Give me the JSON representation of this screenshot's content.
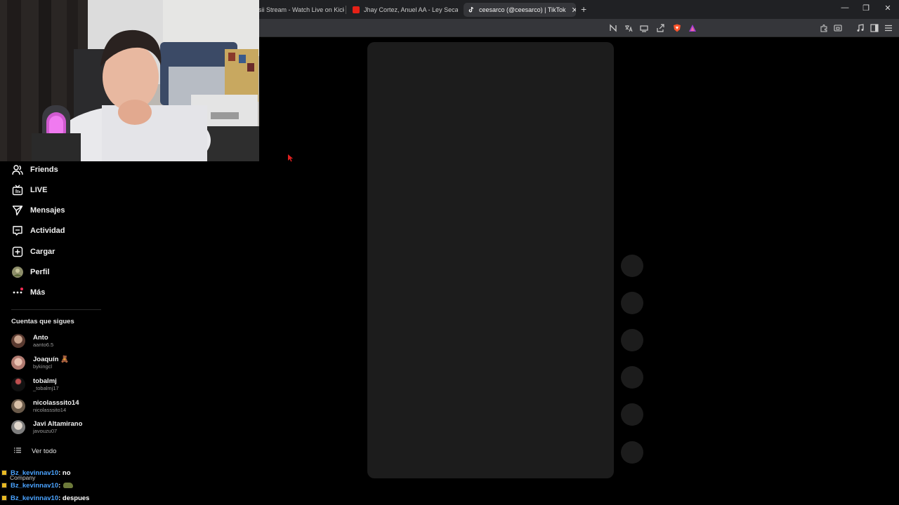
{
  "browser": {
    "tabs": [
      {
        "title": "sii Stream - Watch Live on Kick",
        "active": false,
        "favicon": "kick-icon"
      },
      {
        "title": "Jhay Cortez, Anuel AA - Ley Seca (Offi",
        "active": false,
        "favicon": "youtube-icon"
      },
      {
        "title": "ceesarco (@ceesarco) | TikTok",
        "active": true,
        "favicon": "tiktok-icon"
      }
    ],
    "new_tab_glyph": "+",
    "close_glyph": "✕",
    "window_controls": {
      "minimize": "—",
      "restore": "❐",
      "close": "✕"
    },
    "accent": "#35363a"
  },
  "sidebar": {
    "nav": [
      {
        "label": "Friends",
        "icon": "friends-icon"
      },
      {
        "label": "LIVE",
        "icon": "live-tv-icon"
      },
      {
        "label": "Mensajes",
        "icon": "send-icon"
      },
      {
        "label": "Actividad",
        "icon": "activity-icon"
      },
      {
        "label": "Cargar",
        "icon": "upload-plus-icon"
      },
      {
        "label": "Perfil",
        "icon": "profile-avatar-icon"
      },
      {
        "label": "Más",
        "icon": "more-dots-icon"
      }
    ],
    "following_title": "Cuentas que sigues",
    "accounts": [
      {
        "name": "Anto",
        "handle": "aanto6.5",
        "avatar_color": "#7a5a4a"
      },
      {
        "name": "Joaquín 🧸",
        "handle": "bykingcl",
        "avatar_color": "#c99a8a"
      },
      {
        "name": "tobalmj",
        "handle": "_tobalmj17",
        "avatar_color": "#2a2a2a"
      },
      {
        "name": "nicolasssito14",
        "handle": "nicolasssito14",
        "avatar_color": "#8a7a6a"
      },
      {
        "name": "Javi Altamirano",
        "handle": "javouzu07",
        "avatar_color": "#9a9a9a"
      }
    ],
    "see_all": "Ver todo"
  },
  "chat": {
    "messages": [
      {
        "user": "Bz_kevinnav10",
        "text": " : no",
        "emote": false
      },
      {
        "user": "Bz_kevinnav10",
        "text": " : ",
        "emote": true
      },
      {
        "user": "Bz_kevinnav10",
        "text": " : despues",
        "emote": false
      }
    ],
    "overlay_text": "Company",
    "user_color": "#4aa3ff"
  }
}
